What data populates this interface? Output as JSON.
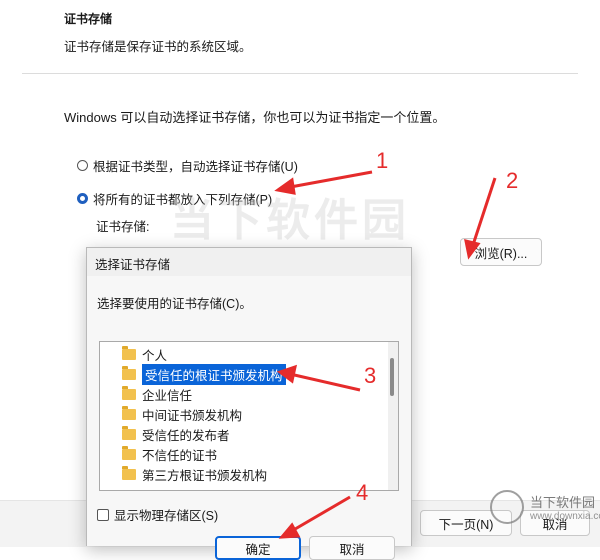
{
  "wizard": {
    "title": "证书存储",
    "description": "证书存储是保存证书的系统区域。",
    "intro": "Windows 可以自动选择证书存储，你也可以为证书指定一个位置。",
    "option_auto": "根据证书类型，自动选择证书存储(U)",
    "option_manual": "将所有的证书都放入下列存储(P)",
    "store_label": "证书存储:",
    "browse_button": "浏览(R)...",
    "next_button": "下一页(N)",
    "cancel_button": "取消"
  },
  "dialog": {
    "title": "选择证书存储",
    "prompt": "选择要使用的证书存储(C)。",
    "stores": [
      "个人",
      "受信任的根证书颁发机构",
      "企业信任",
      "中间证书颁发机构",
      "受信任的发布者",
      "不信任的证书",
      "第三方根证书颁发机构"
    ],
    "selected_index": 1,
    "show_physical": "显示物理存储区(S)",
    "ok_button": "确定",
    "cancel_button": "取消"
  },
  "annotations": [
    "1",
    "2",
    "3",
    "4"
  ],
  "watermark": {
    "site": "当下软件园",
    "url": "www.downxia.com"
  },
  "colors": {
    "accent": "#0a64d8",
    "annotation": "#e52b2b"
  }
}
